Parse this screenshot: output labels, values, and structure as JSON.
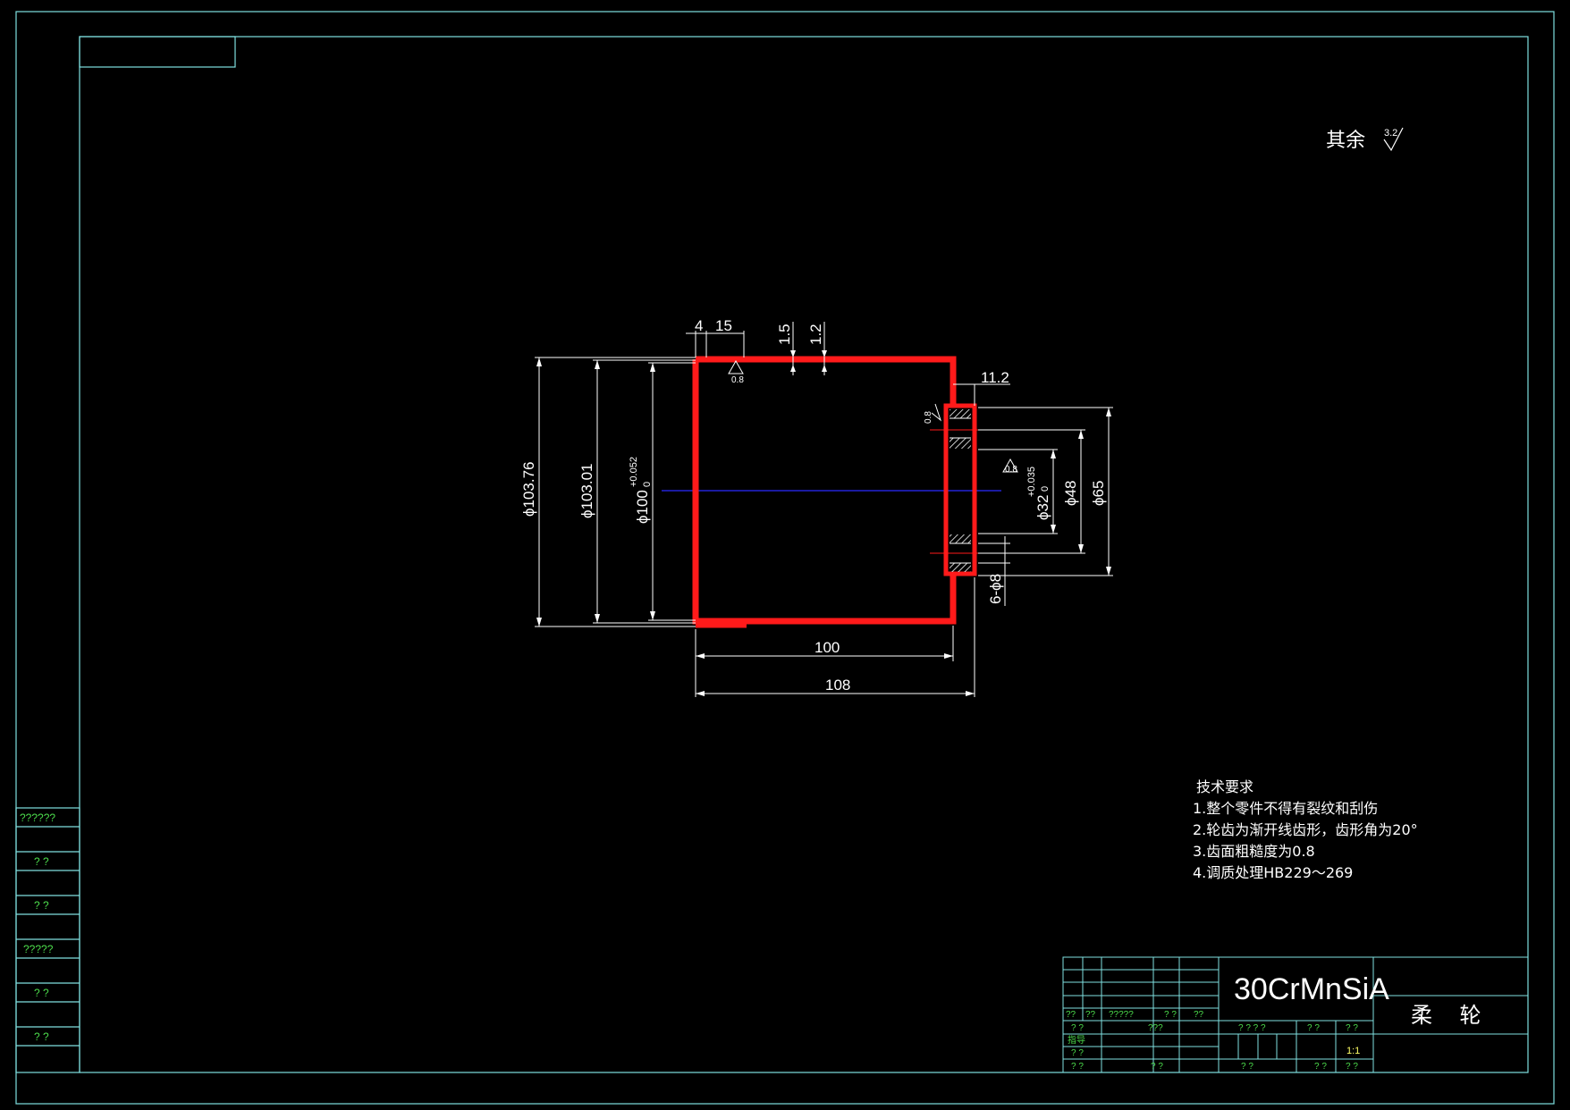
{
  "colors": {
    "background": "#000000",
    "frame": "#7fe0e0",
    "part_outline": "#ff1a1a",
    "dimension": "#ffffff",
    "center_line": "#2a2aff",
    "annotation": "#ffff66",
    "hatching": "#ffffff"
  },
  "roughness_general": {
    "label": "其余",
    "value": "3.2"
  },
  "roughness_marks": [
    "0.8",
    "0.8",
    "0.8"
  ],
  "dimensions": {
    "top": [
      "4",
      "15",
      "1.5",
      "1.2"
    ],
    "right_top": "11.2",
    "dia_outer": "ϕ103.76",
    "dia_mid": "ϕ103.01",
    "dia_inner": "ϕ100",
    "dia_inner_tol_upper": "+0.052",
    "dia_inner_tol_lower": "0",
    "dia_bore": "ϕ32",
    "dia_bore_tol_upper": "+0.035",
    "dia_bore_tol_lower": "0",
    "dia_48": "ϕ48",
    "dia_65": "ϕ65",
    "holes": "6-ϕ8",
    "len_100": "100",
    "len_108": "108"
  },
  "tech_requirements": {
    "title": "技术要求",
    "items": [
      "1.整个零件不得有裂纹和刮伤",
      "2.轮齿为渐开线齿形，齿形角为20°",
      "3.齿面粗糙度为0.8",
      "4.调质处理HB229～269"
    ]
  },
  "title_block": {
    "material": "30CrMnSiA",
    "part_name": "柔    轮",
    "scale": "1:1",
    "header_cells": [
      "??",
      "??",
      "?????",
      "? ?",
      "??"
    ],
    "row_labels": [
      "? ?",
      "指导",
      "? ?",
      "? ?"
    ],
    "mid_cell": "???",
    "bottom_mid": "? ?",
    "weight_label": "? ? ? ?",
    "col_a": "? ?",
    "col_b": "? ?",
    "bottom_right": [
      "? ?",
      "? ?",
      "? ?"
    ]
  },
  "side_strip": [
    "??????",
    "? ?",
    "? ?",
    "?????",
    "? ?",
    "? ?"
  ]
}
